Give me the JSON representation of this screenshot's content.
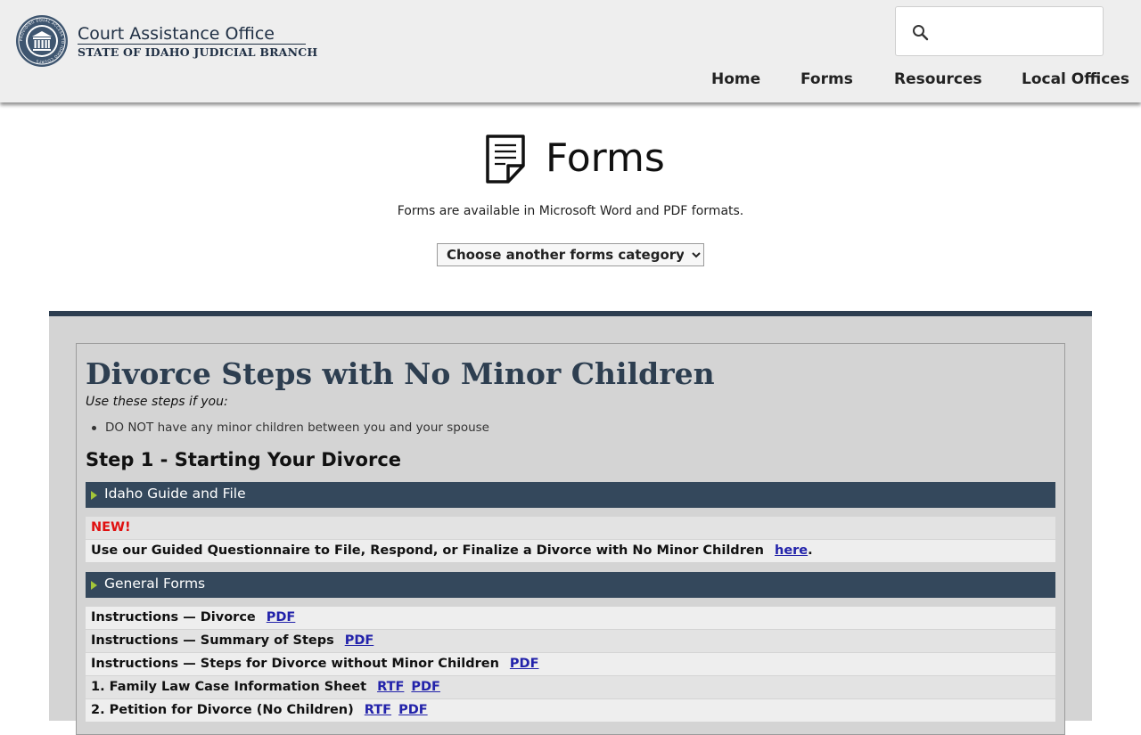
{
  "header": {
    "seal": {
      "icon": "court-seal-icon",
      "ring_text": "PROVIDING EQUAL ACCESS TO IDAHO COURTS"
    },
    "brand_title": "Court Assistance Office",
    "brand_subtitle": "STATE OF IDAHO JUDICIAL BRANCH",
    "search": {
      "icon": "search-icon",
      "placeholder": "",
      "value": ""
    },
    "nav": [
      {
        "label": "Home"
      },
      {
        "label": "Forms"
      },
      {
        "label": "Resources"
      },
      {
        "label": "Local Offices"
      }
    ]
  },
  "hero": {
    "icon": "document-icon",
    "title": "Forms",
    "description": "Forms are available in Microsoft Word and PDF formats.",
    "category_select": {
      "selected": "Choose another forms category"
    }
  },
  "content": {
    "heading": "Divorce Steps with No Minor Children",
    "use_steps_if": "Use these steps if you:",
    "criteria": [
      "DO NOT have any minor children between you and your spouse"
    ],
    "step1_heading": "Step 1 - Starting Your Divorce",
    "sections": [
      {
        "title": "Idaho Guide and File",
        "new_label": "NEW!",
        "text": "Use our Guided Questionnaire to File, Respond, or Finalize a Divorce with No Minor Children",
        "link": "here",
        "trailing": "."
      },
      {
        "title": "General Forms",
        "rows": [
          {
            "label": "Instructions — Divorce",
            "links": [
              "PDF"
            ]
          },
          {
            "label": "Instructions — Summary of Steps",
            "links": [
              "PDF"
            ]
          },
          {
            "label": "Instructions — Steps for Divorce without Minor Children",
            "links": [
              "PDF"
            ]
          },
          {
            "label": "1. Family Law Case Information Sheet",
            "links": [
              "RTF",
              "PDF"
            ]
          },
          {
            "label": "2. Petition for Divorce (No Children)",
            "links": [
              "RTF",
              "PDF"
            ]
          }
        ]
      }
    ]
  },
  "colors": {
    "header_bg": "#eeeeee",
    "brand_navy": "#1f2f44",
    "section_bar": "#34485c",
    "panel_bg": "#d4d4d4",
    "new_red": "#e01010",
    "link_blue": "#2222aa",
    "bullet_green": "#a4c639"
  }
}
